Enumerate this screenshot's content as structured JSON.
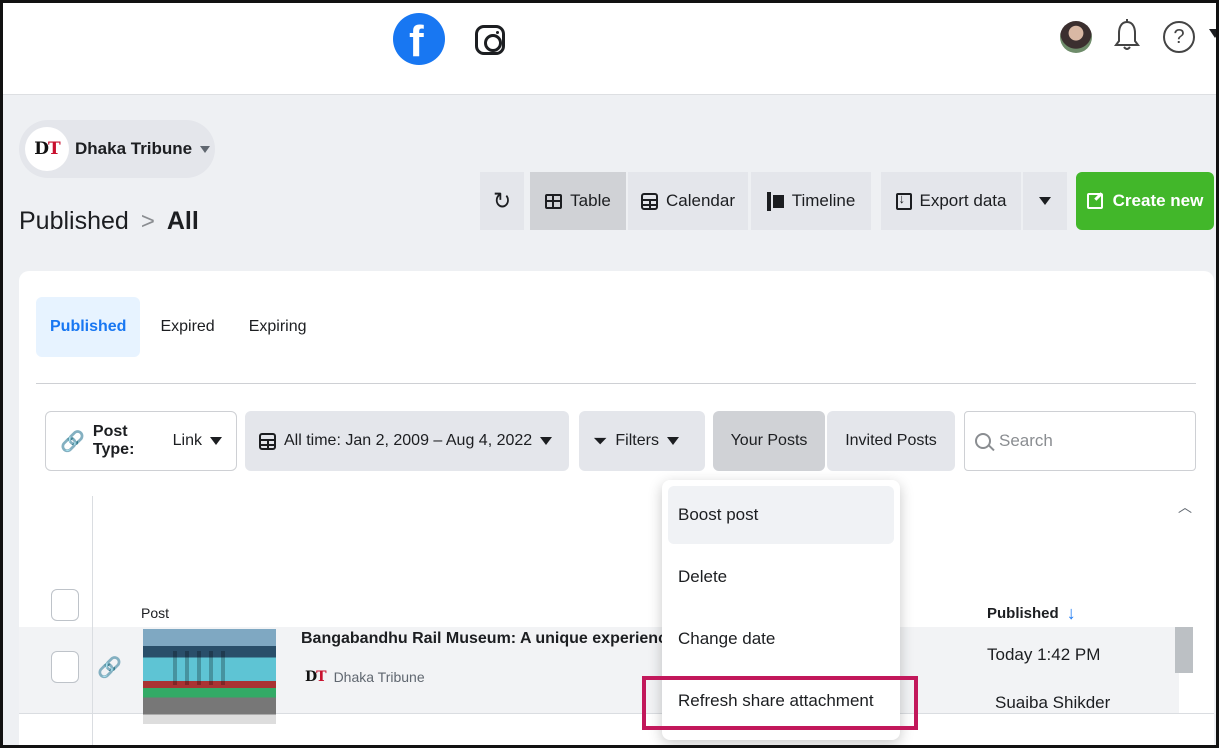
{
  "header": {
    "icons": [
      "facebook-icon",
      "instagram-icon",
      "avatar",
      "bell-icon",
      "help-icon",
      "chevron-down-icon"
    ],
    "help_glyph": "?"
  },
  "page_selector": {
    "badge_d": "D",
    "badge_t": "T",
    "name": "Dhaka Tribune"
  },
  "breadcrumb": {
    "parent": "Published",
    "separator": ">",
    "current": "All"
  },
  "toolbar": {
    "table_label": "Table",
    "calendar_label": "Calendar",
    "timeline_label": "Timeline",
    "export_label": "Export data",
    "create_label": "Create new"
  },
  "tabs": [
    {
      "label": "Published",
      "active": true
    },
    {
      "label": "Expired",
      "active": false
    },
    {
      "label": "Expiring",
      "active": false
    }
  ],
  "filters": {
    "post_type_key": "Post Type:",
    "post_type_value": "Link",
    "date_range": "All time: Jan 2, 2009 – Aug 4, 2022",
    "filters_label": "Filters",
    "your_posts": "Your Posts",
    "invited_posts": "Invited Posts",
    "search_placeholder": "Search"
  },
  "table": {
    "col_post": "Post",
    "col_published": "Published",
    "rows": [
      {
        "title": "Bangabandhu Rail Museum: A unique experience o",
        "page": "Dhaka Tribune",
        "published_time": "Today 1:42 PM",
        "author": "Suaiba Shikder"
      }
    ]
  },
  "menu": {
    "items": [
      "Boost post",
      "Delete",
      "Change date",
      "Refresh share attachment"
    ],
    "highlighted_index": 3
  },
  "colors": {
    "facebook_blue": "#1877f2",
    "create_green": "#42b72a",
    "highlight_magenta": "#c2185b"
  }
}
